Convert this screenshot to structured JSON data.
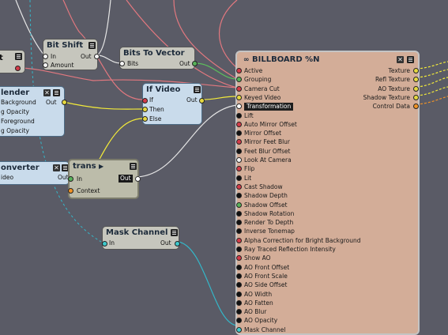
{
  "nodes": {
    "partial_left": {
      "label_out": "t"
    },
    "bit_shift": {
      "title": "Bit Shift",
      "in": "In",
      "amount": "Amount",
      "out": "Out"
    },
    "bits_to_vector": {
      "title": "Bits To Vector",
      "bits": "Bits",
      "out": "Out"
    },
    "blender": {
      "title": "lender",
      "inputs": [
        "Background",
        "g Opacity",
        "Foreground",
        "g Opacity"
      ],
      "out": "Out"
    },
    "if_video": {
      "title": "If Video",
      "inputs": [
        "If",
        "Then",
        "Else"
      ],
      "out": "Out"
    },
    "converter": {
      "title": "onverter",
      "input": "ideo",
      "out": "Out"
    },
    "trans": {
      "title": "trans",
      "arrow": "▶",
      "input": "In",
      "context": "Context",
      "out": "Out"
    },
    "mask_channel": {
      "title": "Mask Channel",
      "in": "In",
      "out": "Out"
    },
    "billboard": {
      "title": "BILLBOARD %N",
      "inputs": [
        "Active",
        "Grouping",
        "Camera Cut",
        "Keyed Video",
        "Transformation",
        "Lift",
        "Auto Mirror Offset",
        "Mirror Offset",
        "Mirror Feet Blur",
        "Feet Blur Offset",
        "Look At Camera",
        "Flip",
        "Lit",
        "Cast Shadow",
        "Shadow Depth",
        "Shadow Offset",
        "Shadow Rotation",
        "Render To Depth",
        "Inverse Tonemap",
        "Alpha Correction for Bright Background",
        "Ray Traced Reflection Intensity",
        "Show AO",
        "AO Front Offset",
        "AO Front Scale",
        "AO Side Offset",
        "AO Width",
        "AO Fatten",
        "AO Blur",
        "AO Opacity",
        "Mask Channel"
      ],
      "input_colors": [
        "red",
        "green",
        "red",
        "yellow",
        "open",
        "black",
        "red",
        "black",
        "red",
        "black",
        "white",
        "red",
        "black",
        "red",
        "black",
        "green",
        "black",
        "black",
        "black",
        "red",
        "black",
        "red",
        "black",
        "black",
        "black",
        "black",
        "black",
        "black",
        "black",
        "teal"
      ],
      "outputs": [
        "Texture",
        "Refl Texture",
        "AO Texture",
        "Shadow Texture",
        "Control Data"
      ],
      "output_colors": [
        "yellow",
        "yellow",
        "yellow",
        "yellow",
        "orange"
      ]
    }
  },
  "colors": {
    "background": "#5a5b66",
    "node_blue": "#c9dbeb",
    "node_gray": "#c6c6bd",
    "billboard": "#d3ad98",
    "wire_red": "#e2787f",
    "wire_yellow": "#f2ea3a",
    "wire_white": "#e6e6e6",
    "wire_cyan": "#34b7c9",
    "wire_green": "#5cbf5c"
  }
}
